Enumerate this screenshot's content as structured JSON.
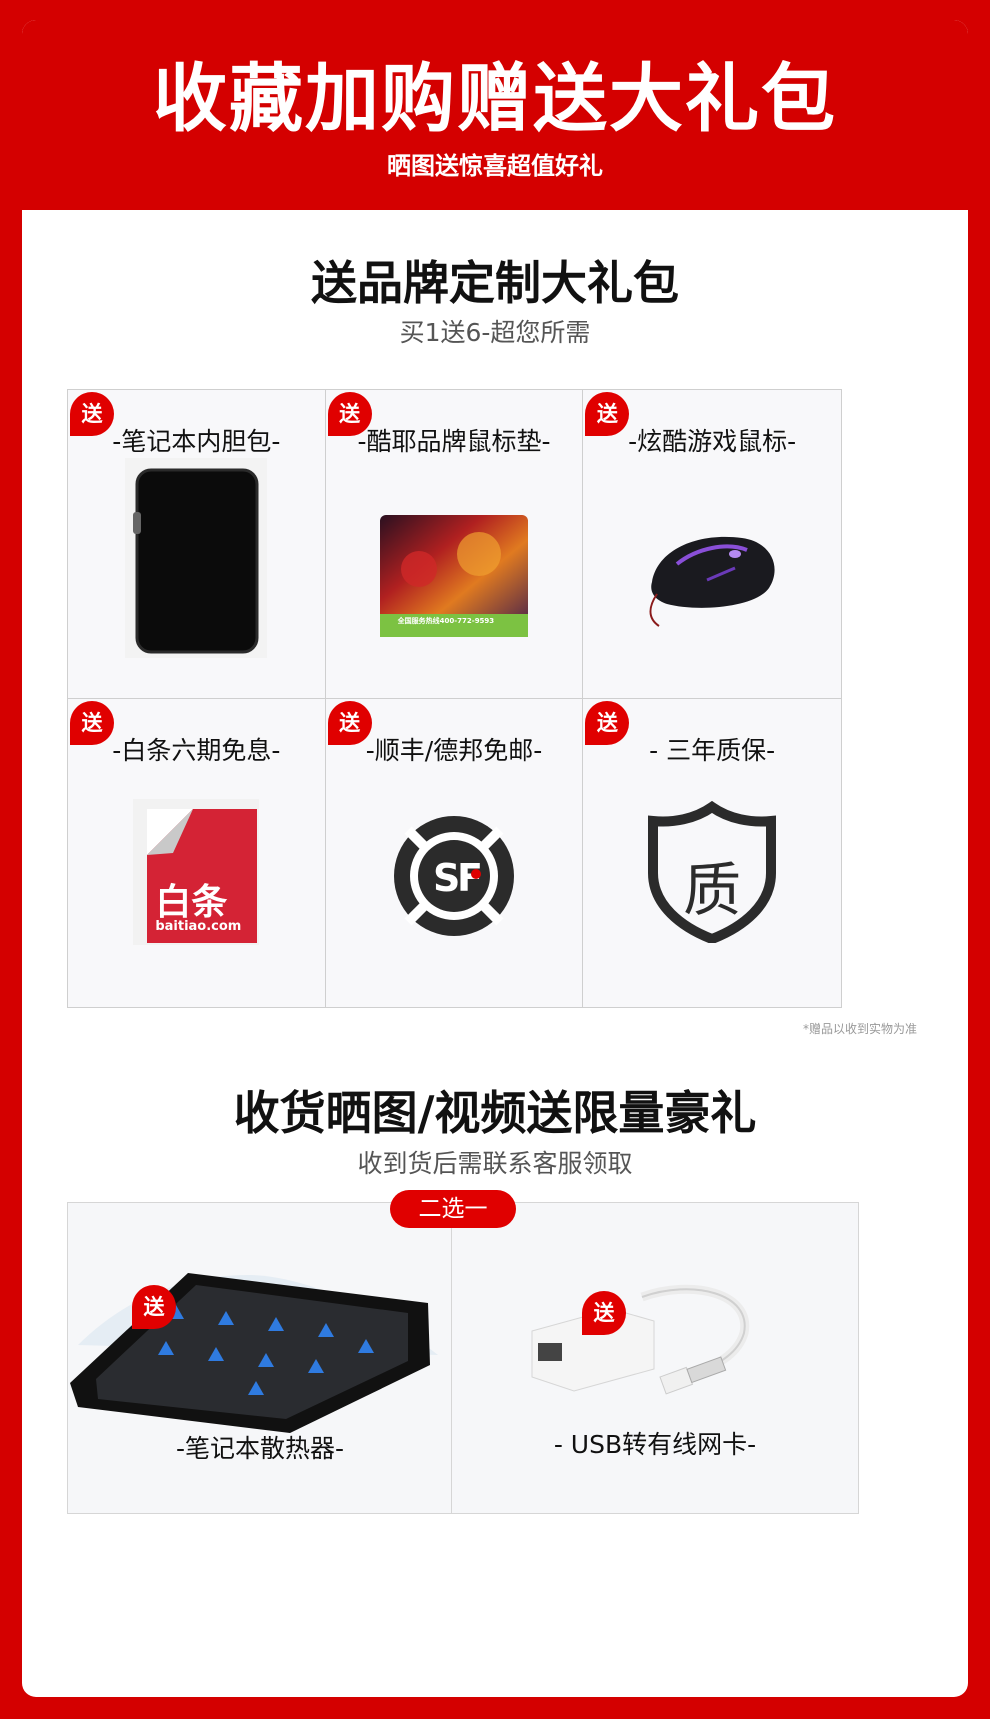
{
  "header": {
    "title": "收藏加购赠送大礼包",
    "subtitle": "晒图送惊喜超值好礼"
  },
  "brand_pack": {
    "title": "送品牌定制大礼包",
    "subtitle": "买1送6-超您所需",
    "badge": "送",
    "items": [
      {
        "label": "-笔记本内胆包-",
        "icon": "laptop-sleeve-image"
      },
      {
        "label": "-酷耶品牌鼠标垫-",
        "icon": "mouse-pad-image"
      },
      {
        "label": "-炫酷游戏鼠标-",
        "icon": "gaming-mouse-image"
      },
      {
        "label": "-白条六期免息-",
        "icon": "baitiao-logo"
      },
      {
        "label": "-顺丰/德邦免邮-",
        "icon": "sf-express-logo"
      },
      {
        "label": "- 三年质保-",
        "icon": "warranty-shield-icon"
      }
    ],
    "mousepad_text": "全国服务热线400-772-9593",
    "baitiao_text": "白条",
    "baitiao_domain": "baitiao.com",
    "shield_char": "质",
    "note": "*赠品以收到实物为准"
  },
  "photo_gift": {
    "title": "收货晒图/视频送限量豪礼",
    "subtitle": "收到货后需联系客服领取",
    "pick_label": "二选一",
    "badge": "送",
    "options": [
      {
        "label": "-笔记本散热器-",
        "icon": "laptop-cooler-image"
      },
      {
        "label": "- USB转有线网卡-",
        "icon": "usb-ethernet-adapter-image"
      }
    ]
  },
  "colors": {
    "accent": "#d40000",
    "badge": "#e00000"
  }
}
